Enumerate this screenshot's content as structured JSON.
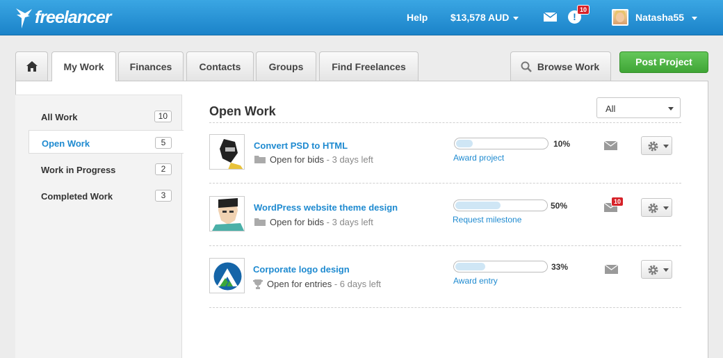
{
  "app": {
    "brand": "freelancer",
    "brand_color": "#1e8ad0",
    "accent_green": "#44aa3a"
  },
  "topbar": {
    "help_label": "Help",
    "balance_label": "$13,578 AUD",
    "messages_icon": "envelope-icon",
    "notifications_icon": "alert-icon",
    "notifications_count": "10",
    "username": "Natasha55"
  },
  "tabs": [
    {
      "label": "",
      "icon": "home-icon"
    },
    {
      "label": "My Work",
      "active": true
    },
    {
      "label": "Finances"
    },
    {
      "label": "Contacts"
    },
    {
      "label": "Groups"
    },
    {
      "label": "Find Freelances"
    }
  ],
  "browse_work_label": "Browse Work",
  "post_project_label": "Post Project",
  "sidebar": {
    "items": [
      {
        "label": "All Work",
        "count": "10"
      },
      {
        "label": "Open Work",
        "count": "5",
        "active": true
      },
      {
        "label": "Work in Progress",
        "count": "2"
      },
      {
        "label": "Completed Work",
        "count": "3"
      }
    ]
  },
  "main": {
    "title": "Open Work",
    "filter_value": "All"
  },
  "projects": [
    {
      "title": "Convert PSD to HTML",
      "status": "Open for bids",
      "time_left": "- 3 days left",
      "status_icon": "folder-icon",
      "progress": 0.1,
      "progress_label": "10%",
      "action": "Award project",
      "message_badge": ""
    },
    {
      "title": "WordPress website theme design",
      "status": "Open for bids",
      "time_left": "- 3 days left",
      "status_icon": "folder-icon",
      "progress": 0.5,
      "progress_label": "50%",
      "action": "Request milestone",
      "message_badge": "10"
    },
    {
      "title": "Corporate logo design",
      "status": "Open for entries",
      "time_left": "- 6 days left",
      "status_icon": "trophy-icon",
      "progress": 0.33,
      "progress_label": "33%",
      "action": "Award entry",
      "message_badge": ""
    }
  ]
}
